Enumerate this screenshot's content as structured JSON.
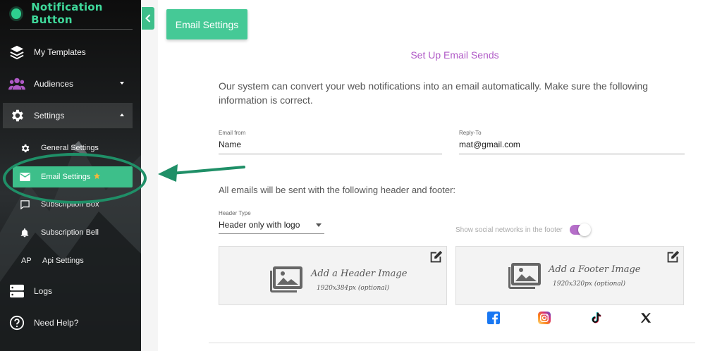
{
  "sidebar": {
    "brand": "Notification Button",
    "items": [
      {
        "label": "My Templates",
        "icon": "layers-icon"
      },
      {
        "label": "Audiences",
        "icon": "users-icon"
      },
      {
        "label": "Settings",
        "icon": "gear-icon"
      }
    ],
    "sub_items": [
      {
        "label": "General Settings",
        "icon": "gear-icon"
      },
      {
        "label": "Email Settings",
        "icon": "mail-icon",
        "active": true
      },
      {
        "label": "Subscription Box",
        "icon": "chat-icon"
      },
      {
        "label": "Subscription Bell",
        "icon": "bell-icon"
      },
      {
        "label": "Api Settings",
        "prefix": "AP"
      }
    ],
    "bottom_items": [
      {
        "label": "Logs",
        "icon": "server-icon"
      },
      {
        "label": "Need Help?",
        "icon": "help-icon"
      }
    ]
  },
  "page": {
    "header": "Email Settings",
    "subtitle": "Set Up Email Sends",
    "intro": "Our system can convert your web notifications into an email automatically. Make sure the following information is correct.",
    "email_from": {
      "label": "Email from",
      "value": "Name"
    },
    "reply_to": {
      "label": "Reply-To",
      "value": "mat@gmail.com"
    },
    "section_text": "All emails will be sent with the following header and footer:",
    "header_type": {
      "label": "Header Type",
      "value": "Header only with logo"
    },
    "social_toggle": {
      "label": "Show social networks in the footer",
      "on": true
    },
    "header_image": {
      "title": "Add a Header Image",
      "size": "1920x384px (optional)"
    },
    "footer_image": {
      "title": "Add a Footer Image",
      "size": "1920x320px (optional)"
    },
    "social_icons": [
      "facebook-icon",
      "instagram-icon",
      "tiktok-icon",
      "x-icon"
    ]
  },
  "colors": {
    "accent": "#3dbf8a",
    "brand": "#3fd89a",
    "subtitle": "#b05ac7",
    "toggle": "#b56ec9",
    "annotation": "#1f8f67"
  }
}
